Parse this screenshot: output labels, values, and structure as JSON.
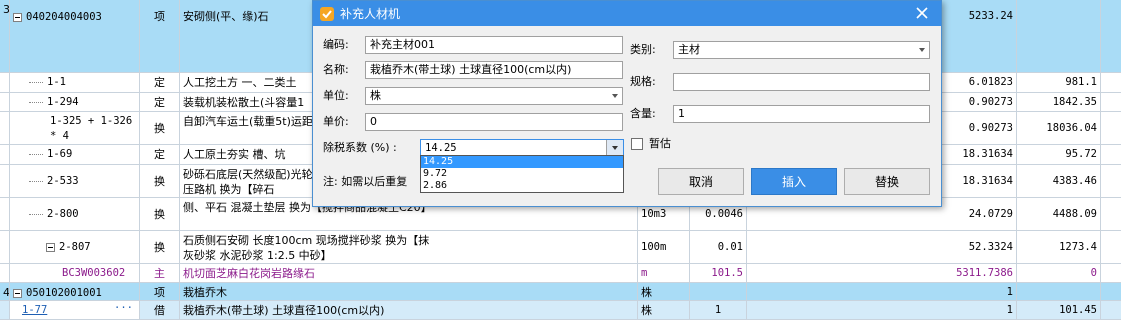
{
  "rows": [
    {
      "index": "3",
      "code": "040204004003",
      "type": "项",
      "name": "安砌侧(平、缘)石",
      "unit": "",
      "qty": "",
      "total": "5233.24",
      "amount": ""
    },
    {
      "code": "1-1",
      "type": "定",
      "name": "人工挖土方 一、二类土",
      "unit": "",
      "qty": "",
      "total": "6.01823",
      "amount": "981.1"
    },
    {
      "code": "1-294",
      "type": "定",
      "name": "装载机装松散土(斗容量1",
      "unit": "",
      "qty": "",
      "total": "0.90273",
      "amount": "1842.35"
    },
    {
      "code": "1-325 + 1-326 * 4",
      "type": "换",
      "name": "自卸汽车运土(载重5t)运距(0m):5",
      "unit": "",
      "qty": "",
      "total": "0.90273",
      "amount": "18036.04"
    },
    {
      "code": "1-69",
      "type": "定",
      "name": "人工原土夯实 槽、坑",
      "unit": "",
      "qty": "",
      "total": "18.31634",
      "amount": "95.72"
    },
    {
      "code": "2-533",
      "type": "换",
      "name": "砂砾石底层(天然级配)光轮压路机 换为【碎石",
      "unit": "",
      "qty": "",
      "total": "18.31634",
      "amount": "4383.46"
    },
    {
      "code": "2-800",
      "type": "换",
      "name": "侧、平石 混凝土垫层 换为【搅拌商品混凝土C20】",
      "unit": "10m3",
      "qty": "0.0046",
      "total": "24.0729",
      "amount": "4488.09"
    },
    {
      "code": "2-807",
      "type": "换",
      "name": "石质侧石安砌 长度100cm 现场搅拌砂浆 换为【抹灰砂浆 水泥砂浆 1:2.5 中砂】",
      "unit": "100m",
      "qty": "0.01",
      "total": "52.3324",
      "amount": "1273.4"
    },
    {
      "code": "BC3W003602",
      "type": "主",
      "name": "机切面芝麻白花岗岩路缘石",
      "unit": "m",
      "qty": "101.5",
      "total": "5311.7386",
      "amount": "0"
    },
    {
      "index": "4",
      "code": "050102001001",
      "type": "项",
      "name": "栽植乔木",
      "unit": "株",
      "qty": "",
      "total": "1",
      "amount": ""
    },
    {
      "code": "1-77",
      "type": "借",
      "name": "栽植乔木(带土球) 土球直径100(cm以内)",
      "unit": "株",
      "qty": "1",
      "total": "1",
      "amount": "101.45",
      "ellipsis": "···"
    }
  ],
  "dialog": {
    "title": "补充人材机",
    "code_label": "编码:",
    "code_value": "补充主材001",
    "name_label": "名称:",
    "name_value": "栽植乔木(带土球) 土球直径100(cm以内)",
    "unit_label": "单位:",
    "unit_value": "株",
    "price_label": "单价:",
    "price_value": "0",
    "tax_label": "除税系数 (%) :",
    "tax_value": "14.25",
    "tax_options": [
      "14.25",
      "9.72",
      "2.86"
    ],
    "note": "注: 如需以后重复",
    "category_label": "类别:",
    "category_value": "主材",
    "spec_label": "规格:",
    "spec_value": "",
    "content_label": "含量:",
    "content_value": "1",
    "estimate_label": "暂估",
    "cancel_label": "取消",
    "insert_label": "插入",
    "replace_label": "替换"
  },
  "colors": {
    "header_row": "#a9dcf6",
    "accent": "#3a8ee6",
    "main_material": "#8b1a8b"
  }
}
